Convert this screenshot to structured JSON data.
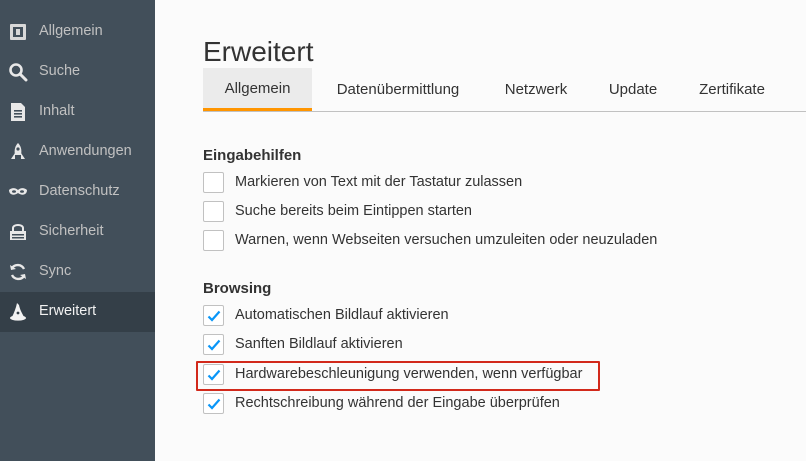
{
  "sidebar": {
    "items": [
      {
        "label": "Allgemein",
        "icon": "general-icon"
      },
      {
        "label": "Suche",
        "icon": "search-icon"
      },
      {
        "label": "Inhalt",
        "icon": "content-icon"
      },
      {
        "label": "Anwendungen",
        "icon": "applications-icon"
      },
      {
        "label": "Datenschutz",
        "icon": "privacy-mask-icon"
      },
      {
        "label": "Sicherheit",
        "icon": "security-icon"
      },
      {
        "label": "Sync",
        "icon": "sync-icon"
      },
      {
        "label": "Erweitert",
        "icon": "advanced-wizard-hat-icon",
        "selected": true
      }
    ]
  },
  "main": {
    "title": "Erweitert",
    "tabs": [
      {
        "label": "Allgemein",
        "selected": true
      },
      {
        "label": "Datenübermittlung"
      },
      {
        "label": "Netzwerk"
      },
      {
        "label": "Update"
      },
      {
        "label": "Zertifikate"
      }
    ],
    "accessibility": {
      "heading": "Eingabehilfen",
      "options": [
        {
          "label": "Markieren von Text mit der Tastatur zulassen",
          "checked": false
        },
        {
          "label": "Suche bereits beim Eintippen starten",
          "checked": false
        },
        {
          "label": "Warnen, wenn Webseiten versuchen umzuleiten oder neuzuladen",
          "checked": false
        }
      ]
    },
    "browsing": {
      "heading": "Browsing",
      "options": [
        {
          "label": "Automatischen Bildlauf aktivieren",
          "checked": true
        },
        {
          "label": "Sanften Bildlauf aktivieren",
          "checked": true
        },
        {
          "label": "Hardwarebeschleunigung verwenden, wenn verfügbar",
          "checked": true,
          "highlighted": true
        },
        {
          "label": "Rechtschreibung während der Eingabe überprüfen",
          "checked": true
        }
      ]
    }
  },
  "colors": {
    "sidebar_bg": "#424f5a",
    "sidebar_selected_bg": "#343f48",
    "tab_accent": "#ff9500",
    "checkmark": "#0996f8",
    "highlight_border": "#d2291b"
  }
}
